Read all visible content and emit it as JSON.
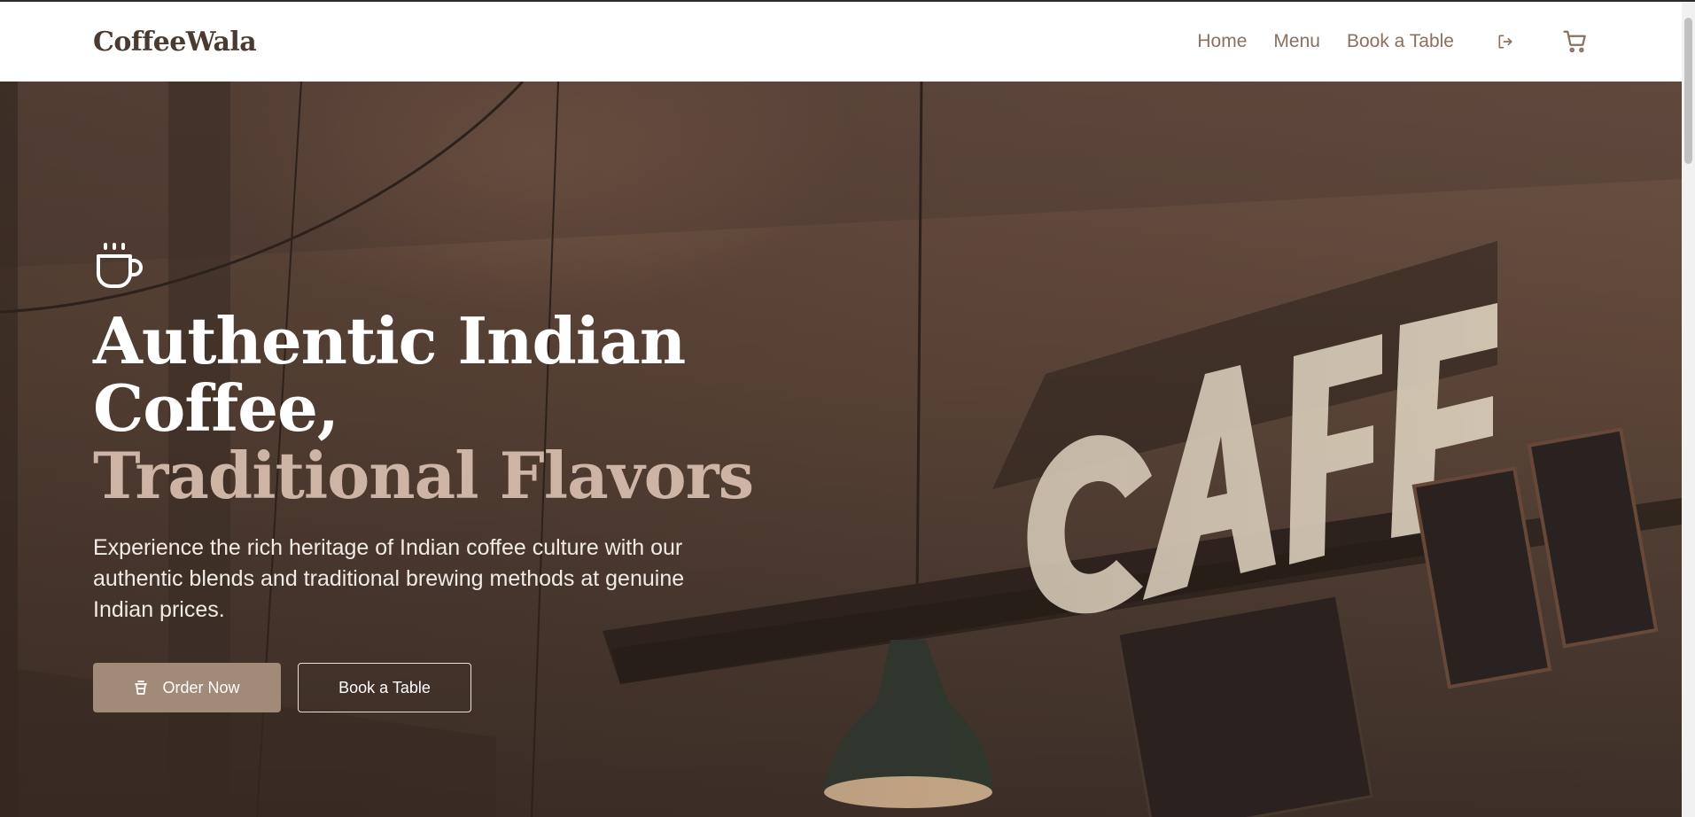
{
  "nav": {
    "brand": "CoffeeWala",
    "links": [
      "Home",
      "Menu",
      "Book a Table"
    ],
    "icons": [
      "logout-icon",
      "cart-icon"
    ]
  },
  "hero": {
    "icon": "coffee-cup-icon",
    "headline_line1": "Authentic Indian Coffee,",
    "headline_line2": "Traditional Flavors",
    "subtext": "Experience the rich heritage of Indian coffee culture with our authentic blends and traditional brewing methods at genuine Indian prices.",
    "primary_button": "Order Now",
    "primary_button_icon": "takeaway-cup-icon",
    "secondary_button": "Book a Table",
    "background_sign": "CAFE"
  },
  "colors": {
    "brand": "#4a3a30",
    "nav_link": "#8a7060",
    "accent_text": "#cdb4a5",
    "primary_button": "#a28a78"
  }
}
